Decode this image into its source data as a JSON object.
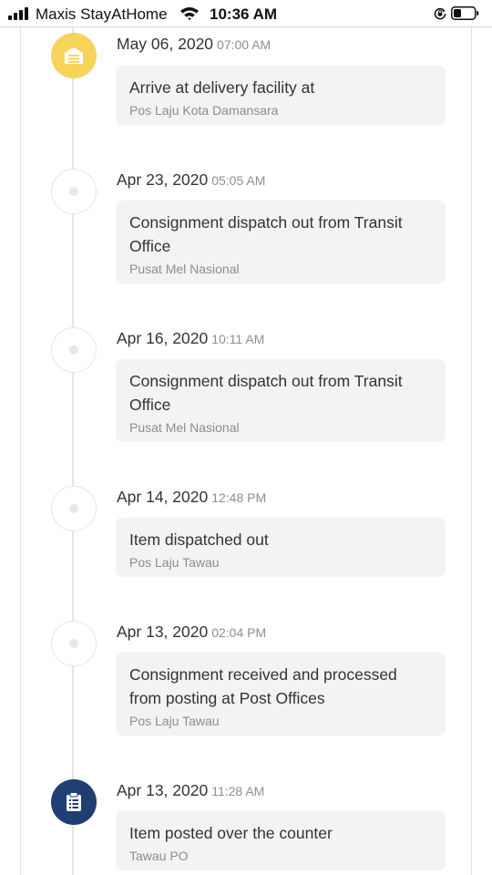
{
  "status_bar": {
    "carrier": "Maxis StayAtHome",
    "time": "10:36 AM",
    "icons": [
      "signal-icon",
      "wifi-icon",
      "orientation-lock-icon",
      "battery-icon"
    ]
  },
  "timeline": {
    "events": [
      {
        "date": "May 06, 2020",
        "time": "07:00 AM",
        "description": "Arrive at delivery facility at",
        "location": "Pos Laju Kota Damansara",
        "marker": "warehouse-icon",
        "marker_color": "#f6d45c"
      },
      {
        "date": "Apr 23, 2020",
        "time": "05:05 AM",
        "description": "Consignment dispatch out from Transit Office",
        "location": "Pusat Mel Nasional",
        "marker": "dot",
        "marker_color": "#ffffff"
      },
      {
        "date": "Apr 16, 2020",
        "time": "10:11 AM",
        "description": "Consignment dispatch out from Transit Office",
        "location": "Pusat Mel Nasional",
        "marker": "dot",
        "marker_color": "#ffffff"
      },
      {
        "date": "Apr 14, 2020",
        "time": "12:48 PM",
        "description": "Item dispatched out",
        "location": "Pos Laju Tawau",
        "marker": "dot",
        "marker_color": "#ffffff"
      },
      {
        "date": "Apr 13, 2020",
        "time": "02:04 PM",
        "description": "Consignment received and processed from posting at Post Offices",
        "location": "Pos Laju Tawau",
        "marker": "dot",
        "marker_color": "#ffffff"
      },
      {
        "date": "Apr 13, 2020",
        "time": "11:28 AM",
        "description": "Item posted over the counter",
        "location": "Tawau PO",
        "marker": "clipboard-icon",
        "marker_color": "#1f3e72"
      }
    ]
  }
}
